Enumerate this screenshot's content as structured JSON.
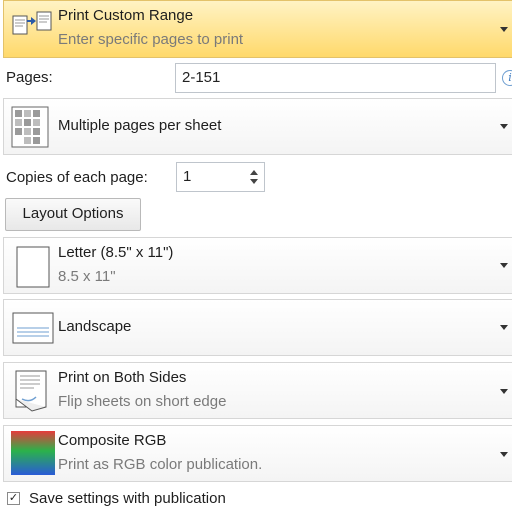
{
  "print_range": {
    "title": "Print Custom Range",
    "subtitle": "Enter specific pages to print"
  },
  "pages": {
    "label": "Pages:",
    "value": "2-151"
  },
  "pages_per_sheet": {
    "title": "Multiple pages per sheet"
  },
  "copies": {
    "label": "Copies of each page:",
    "value": "1"
  },
  "layout_options": {
    "label": "Layout Options"
  },
  "paper": {
    "title": "Letter (8.5\" x 11\")",
    "subtitle": "8.5 x 11\""
  },
  "orientation": {
    "title": "Landscape"
  },
  "duplex": {
    "title": "Print on Both Sides",
    "subtitle": "Flip sheets on short edge"
  },
  "color": {
    "title": "Composite RGB",
    "subtitle": "Print as RGB color publication."
  },
  "save_settings": {
    "label": "Save settings with publication",
    "checked": "✓"
  },
  "info": {
    "glyph": "i"
  },
  "colors": {
    "active_bg": "#ffd96b",
    "border": "#d6d6d6"
  }
}
